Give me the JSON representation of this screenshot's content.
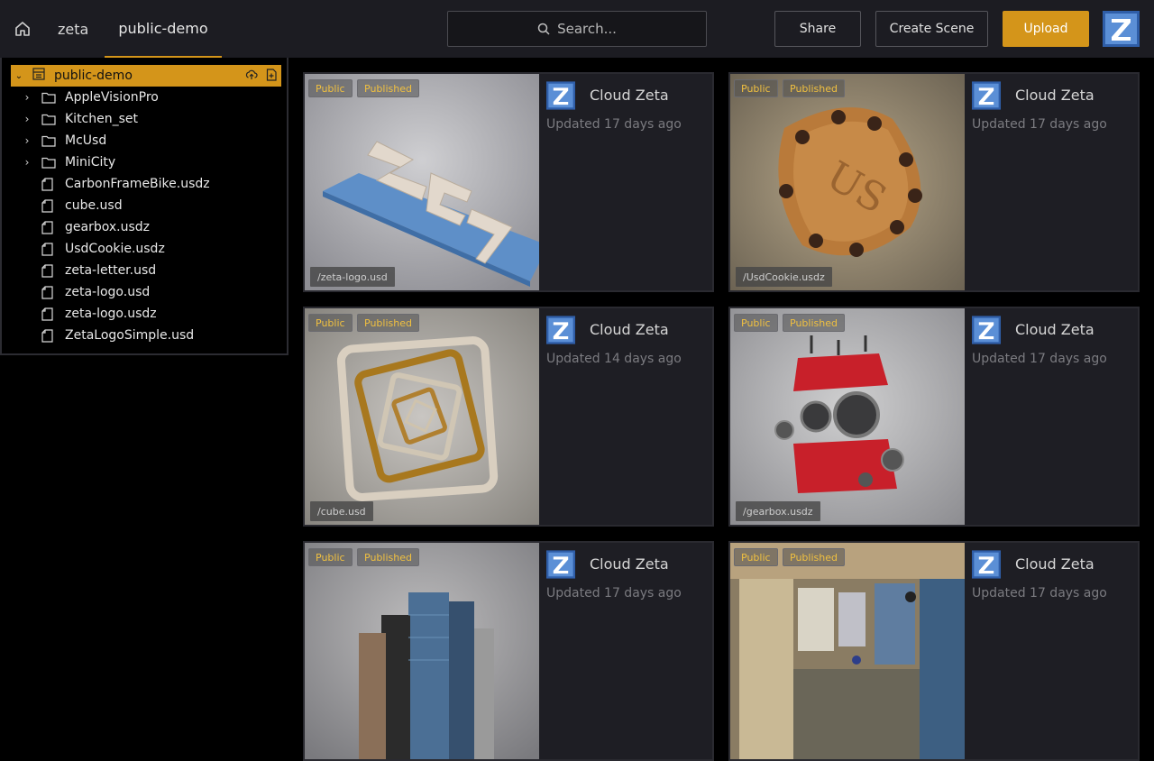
{
  "nav": {
    "crumbs": [
      "zeta",
      "public-demo"
    ],
    "search_placeholder": "Search...",
    "share_label": "Share",
    "create_label": "Create Scene",
    "upload_label": "Upload",
    "accent": "#d4951a"
  },
  "tree": {
    "root": "public-demo",
    "folders": [
      "AppleVisionPro",
      "Kitchen_set",
      "McUsd",
      "MiniCity"
    ],
    "files": [
      "CarbonFrameBike.usdz",
      "cube.usd",
      "gearbox.usdz",
      "UsdCookie.usdz",
      "zeta-letter.usd",
      "zeta-logo.usd",
      "zeta-logo.usdz",
      "ZetaLogoSimple.usd"
    ]
  },
  "cards": [
    {
      "badge1": "Public",
      "badge2": "Published",
      "owner": "Cloud Zeta",
      "updated": "Updated 17 days ago",
      "path": "/zeta-logo.usd",
      "thumb": "zeta-logo-render"
    },
    {
      "badge1": "Public",
      "badge2": "Published",
      "owner": "Cloud Zeta",
      "updated": "Updated 17 days ago",
      "path": "/UsdCookie.usdz",
      "thumb": "cookie-render"
    },
    {
      "badge1": "Public",
      "badge2": "Published",
      "owner": "Cloud Zeta",
      "updated": "Updated 14 days ago",
      "path": "/cube.usd",
      "thumb": "cube-frames-render"
    },
    {
      "badge1": "Public",
      "badge2": "Published",
      "owner": "Cloud Zeta",
      "updated": "Updated 17 days ago",
      "path": "/gearbox.usdz",
      "thumb": "gearbox-render"
    },
    {
      "badge1": "Public",
      "badge2": "Published",
      "owner": "Cloud Zeta",
      "updated": "Updated 17 days ago",
      "path": "",
      "thumb": "city-render"
    },
    {
      "badge1": "Public",
      "badge2": "Published",
      "owner": "Cloud Zeta",
      "updated": "Updated 17 days ago",
      "path": "",
      "thumb": "kitchen-render"
    }
  ]
}
